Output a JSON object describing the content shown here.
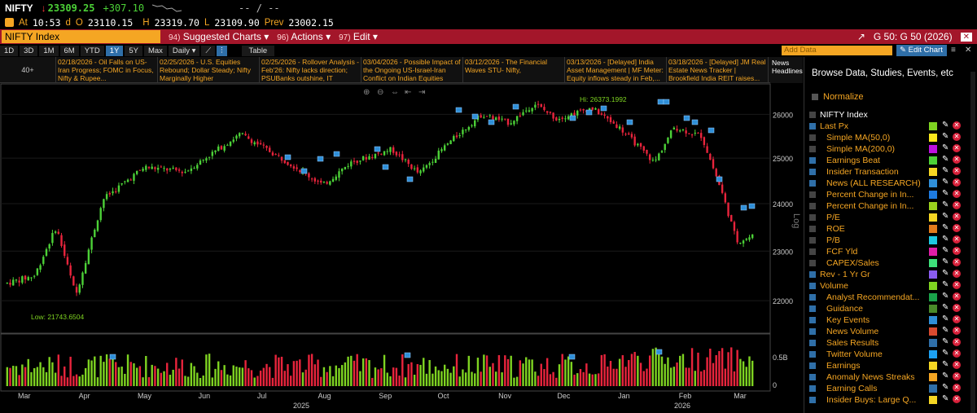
{
  "quote": {
    "ticker": "NIFTY",
    "arrow": "↓",
    "last": "23309.25",
    "change": "+307.10",
    "placeholder": "-- / --",
    "at_label": "At",
    "time": "10:53",
    "d_label": "d",
    "open_label": "O",
    "open": "23110.15",
    "high_label": "H",
    "high": "23319.70",
    "low_label": "L",
    "low": "23109.90",
    "prev_label": "Prev",
    "prev": "23002.15"
  },
  "titlebar": {
    "title": "NIFTY Index",
    "suggested_num": "94)",
    "suggested": "Suggested Charts",
    "actions_num": "96)",
    "actions": "Actions",
    "edit_num": "97)",
    "edit": "Edit",
    "right_label": "G 50: G 50 (2026)"
  },
  "toolbar": {
    "ranges": [
      "1D",
      "3D",
      "1M",
      "6M",
      "YTD",
      "1Y",
      "5Y",
      "Max"
    ],
    "active_range": "1Y",
    "frequency": "Daily",
    "table": "Table",
    "add_data_placeholder": "Add Data",
    "edit_chart": "Edit Chart"
  },
  "news": {
    "more": "40+",
    "headlines_label": "News Headlines",
    "items": [
      "02/18/2026 - Oil Falls on US-Iran Progress; FOMC in Focus, Nifty & Rupee...",
      "02/25/2026 - U.S. Equities Rebound; Dollar Steady; Nifty Marginally Higher",
      "02/25/2026 - Rollover Analysis - Feb'26: Nifty lacks direction; PSUBanks outshine, IT slipped...",
      "03/04/2026 - Possible Impact of the Ongoing US-Israel-Iran Conflict on Indian Equities",
      "03/12/2026 - The Financial Waves STU- Nifty,",
      "03/13/2026 - [Delayed] India Asset Management | MF Meter: Equity inflows steady in Feb,...",
      "03/18/2026 - [Delayed] JM Real Estate News Tracker | Brookfield India REIT raises..."
    ]
  },
  "chart_data": {
    "type": "candlestick",
    "title": "NIFTY Index",
    "scale": "log",
    "axis_label": "Log",
    "y_ticks": [
      22000,
      23000,
      24000,
      25000,
      26000
    ],
    "ylim": [
      21400,
      26700
    ],
    "volume_ticks": [
      "0.5B",
      "0"
    ],
    "x_months": [
      "Mar",
      "Apr",
      "May",
      "Jun",
      "Jul",
      "Aug",
      "Sep",
      "Oct",
      "Nov",
      "Dec",
      "Jan",
      "Feb",
      "Mar"
    ],
    "x_years": [
      "2025",
      "2026"
    ],
    "high_annotation": "Hi: 26373.1992",
    "low_annotation": "Low: 21743.6504",
    "price_path": [
      {
        "x": "2025-03-03",
        "y": 22350
      },
      {
        "x": "2025-03-17",
        "y": 22500
      },
      {
        "x": "2025-03-28",
        "y": 23500
      },
      {
        "x": "2025-04-07",
        "y": 22100
      },
      {
        "x": "2025-04-21",
        "y": 24100
      },
      {
        "x": "2025-05-12",
        "y": 24800
      },
      {
        "x": "2025-06-02",
        "y": 24700
      },
      {
        "x": "2025-06-30",
        "y": 25550
      },
      {
        "x": "2025-07-28",
        "y": 24800
      },
      {
        "x": "2025-08-11",
        "y": 24400
      },
      {
        "x": "2025-08-25",
        "y": 24900
      },
      {
        "x": "2025-09-15",
        "y": 25200
      },
      {
        "x": "2025-09-29",
        "y": 24650
      },
      {
        "x": "2025-10-13",
        "y": 25300
      },
      {
        "x": "2025-10-31",
        "y": 26000
      },
      {
        "x": "2025-11-14",
        "y": 25800
      },
      {
        "x": "2025-11-27",
        "y": 26250
      },
      {
        "x": "2025-12-08",
        "y": 25900
      },
      {
        "x": "2025-12-26",
        "y": 26150
      },
      {
        "x": "2026-01-09",
        "y": 25700
      },
      {
        "x": "2026-01-27",
        "y": 24900
      },
      {
        "x": "2026-02-06",
        "y": 25700
      },
      {
        "x": "2026-02-20",
        "y": 25500
      },
      {
        "x": "2026-03-02",
        "y": 24300
      },
      {
        "x": "2026-03-10",
        "y": 23200
      },
      {
        "x": "2026-03-18",
        "y": 23309
      }
    ]
  },
  "panel": {
    "browse": "Browse Data, Studies, Events, etc",
    "normalize": "Normalize",
    "legend": [
      {
        "label": "NIFTY Index",
        "on": false,
        "white": true,
        "swatch": "",
        "icon": ""
      },
      {
        "label": "Last Px",
        "on": true,
        "white": false,
        "swatch": "#7ed321",
        "icon": ""
      },
      {
        "label": "Simple MA(50,0)",
        "on": false,
        "white": false,
        "swatch": "#f8e71c",
        "icon": ""
      },
      {
        "label": "Simple MA(200,0)",
        "on": false,
        "white": false,
        "swatch": "#bd10e0",
        "icon": ""
      },
      {
        "label": "Earnings Beat",
        "on": true,
        "white": false,
        "swatch": "#4cd137",
        "icon": "check-icon"
      },
      {
        "label": "Insider Transaction",
        "on": true,
        "white": false,
        "swatch": "#f5d623",
        "icon": "insider-icon"
      },
      {
        "label": "News (ALL RESEARCH)",
        "on": true,
        "white": false,
        "swatch": "#2f8fd8",
        "icon": "news-icon"
      },
      {
        "label": "Percent Change in In...",
        "on": false,
        "white": false,
        "swatch": "#1e7be0",
        "icon": ""
      },
      {
        "label": "Percent Change in In...",
        "on": false,
        "white": false,
        "swatch": "#9ad11e",
        "icon": ""
      },
      {
        "label": "P/E",
        "on": false,
        "white": false,
        "swatch": "#f5d623",
        "icon": ""
      },
      {
        "label": "ROE",
        "on": false,
        "white": false,
        "swatch": "#e37b1c",
        "icon": ""
      },
      {
        "label": "P/B",
        "on": false,
        "white": false,
        "swatch": "#1ec8e0",
        "icon": ""
      },
      {
        "label": "FCF Yld",
        "on": false,
        "white": false,
        "swatch": "#e01ea8",
        "icon": ""
      },
      {
        "label": "CAPEX/Sales",
        "on": false,
        "white": false,
        "swatch": "#3ee07a",
        "icon": ""
      },
      {
        "label": "Rev - 1 Yr Gr",
        "on": true,
        "white": false,
        "swatch": "#8a5cf0",
        "icon": ""
      },
      {
        "label": "Volume",
        "on": true,
        "white": false,
        "swatch": "#7ed321",
        "icon": ""
      },
      {
        "label": "Analyst Recommendat...",
        "on": true,
        "white": false,
        "swatch": "#1aa34a",
        "icon": "house-icon"
      },
      {
        "label": "Guidance",
        "on": true,
        "white": false,
        "swatch": "#4a8a2a",
        "icon": "guidance-icon"
      },
      {
        "label": "Key Events",
        "on": true,
        "white": false,
        "swatch": "#2f8fd8",
        "icon": "key-events-icon"
      },
      {
        "label": "News Volume",
        "on": true,
        "white": false,
        "swatch": "#d84a2f",
        "icon": "news-volume-icon"
      },
      {
        "label": "Sales Results",
        "on": true,
        "white": false,
        "swatch": "#2f6fa8",
        "icon": "sales-icon"
      },
      {
        "label": "Twitter Volume",
        "on": true,
        "white": false,
        "swatch": "#1da1f2",
        "icon": "twitter-icon"
      },
      {
        "label": "Earnings",
        "on": true,
        "white": false,
        "swatch": "#f5d623",
        "icon": "earnings-icon"
      },
      {
        "label": "Anomaly News Streaks",
        "on": true,
        "white": false,
        "swatch": "#f5a623",
        "icon": "anomaly-icon"
      },
      {
        "label": "Earning Calls",
        "on": true,
        "white": false,
        "swatch": "#2f6fa8",
        "icon": "calls-icon"
      },
      {
        "label": "Insider Buys: Large Q...",
        "on": true,
        "white": false,
        "swatch": "#f5d623",
        "icon": "insider-buys-icon"
      }
    ]
  }
}
